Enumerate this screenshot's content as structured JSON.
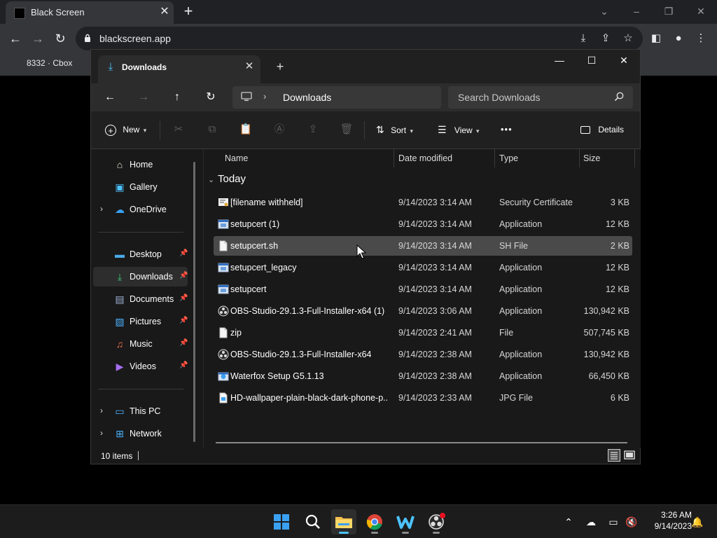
{
  "browser": {
    "tab_title": "Black Screen",
    "url": "blackscreen.app",
    "bookmark": "8332 · Cbox"
  },
  "explorer": {
    "tab_title": "Downloads",
    "breadcrumb": "Downloads",
    "search_placeholder": "Search Downloads",
    "toolbar": {
      "new_label": "New",
      "sort_label": "Sort",
      "view_label": "View",
      "more_label": "•••",
      "details_label": "Details"
    },
    "sidebar": {
      "home": "Home",
      "gallery": "Gallery",
      "onedrive": "OneDrive",
      "desktop": "Desktop",
      "downloads": "Downloads",
      "documents": "Documents",
      "pictures": "Pictures",
      "music": "Music",
      "videos": "Videos",
      "thispc": "This PC",
      "network": "Network"
    },
    "columns": {
      "name": "Name",
      "date": "Date modified",
      "type": "Type",
      "size": "Size"
    },
    "group": "Today",
    "files": [
      {
        "name": "[filename withheld]",
        "date": "9/14/2023 3:14 AM",
        "type": "Security Certificate",
        "size": "3 KB",
        "icon": "certificate-icon"
      },
      {
        "name": "setupcert (1)",
        "date": "9/14/2023 3:14 AM",
        "type": "Application",
        "size": "12 KB",
        "icon": "application-icon"
      },
      {
        "name": "setupcert.sh",
        "date": "9/14/2023 3:14 AM",
        "type": "SH File",
        "size": "2 KB",
        "icon": "file-icon"
      },
      {
        "name": "setupcert_legacy",
        "date": "9/14/2023 3:14 AM",
        "type": "Application",
        "size": "12 KB",
        "icon": "application-icon"
      },
      {
        "name": "setupcert",
        "date": "9/14/2023 3:14 AM",
        "type": "Application",
        "size": "12 KB",
        "icon": "application-icon"
      },
      {
        "name": "OBS-Studio-29.1.3-Full-Installer-x64 (1)",
        "date": "9/14/2023 3:06 AM",
        "type": "Application",
        "size": "130,942 KB",
        "icon": "obs-icon"
      },
      {
        "name": "zip",
        "date": "9/14/2023 2:41 AM",
        "type": "File",
        "size": "507,745 KB",
        "icon": "file-icon"
      },
      {
        "name": "OBS-Studio-29.1.3-Full-Installer-x64",
        "date": "9/14/2023 2:38 AM",
        "type": "Application",
        "size": "130,942 KB",
        "icon": "obs-icon"
      },
      {
        "name": "Waterfox Setup G5.1.13",
        "date": "9/14/2023 2:38 AM",
        "type": "Application",
        "size": "66,450 KB",
        "icon": "installer-icon"
      },
      {
        "name": "HD-wallpaper-plain-black-dark-phone-p...",
        "date": "9/14/2023 2:33 AM",
        "type": "JPG File",
        "size": "6 KB",
        "icon": "image-file-icon"
      }
    ],
    "selected_file": "setupcert.sh",
    "status": "10 items"
  },
  "taskbar": {
    "time": "3:26 AM",
    "date": "9/14/2023"
  },
  "colors": {
    "accent": "#4cc2ff",
    "folder": "#f4c04e"
  }
}
